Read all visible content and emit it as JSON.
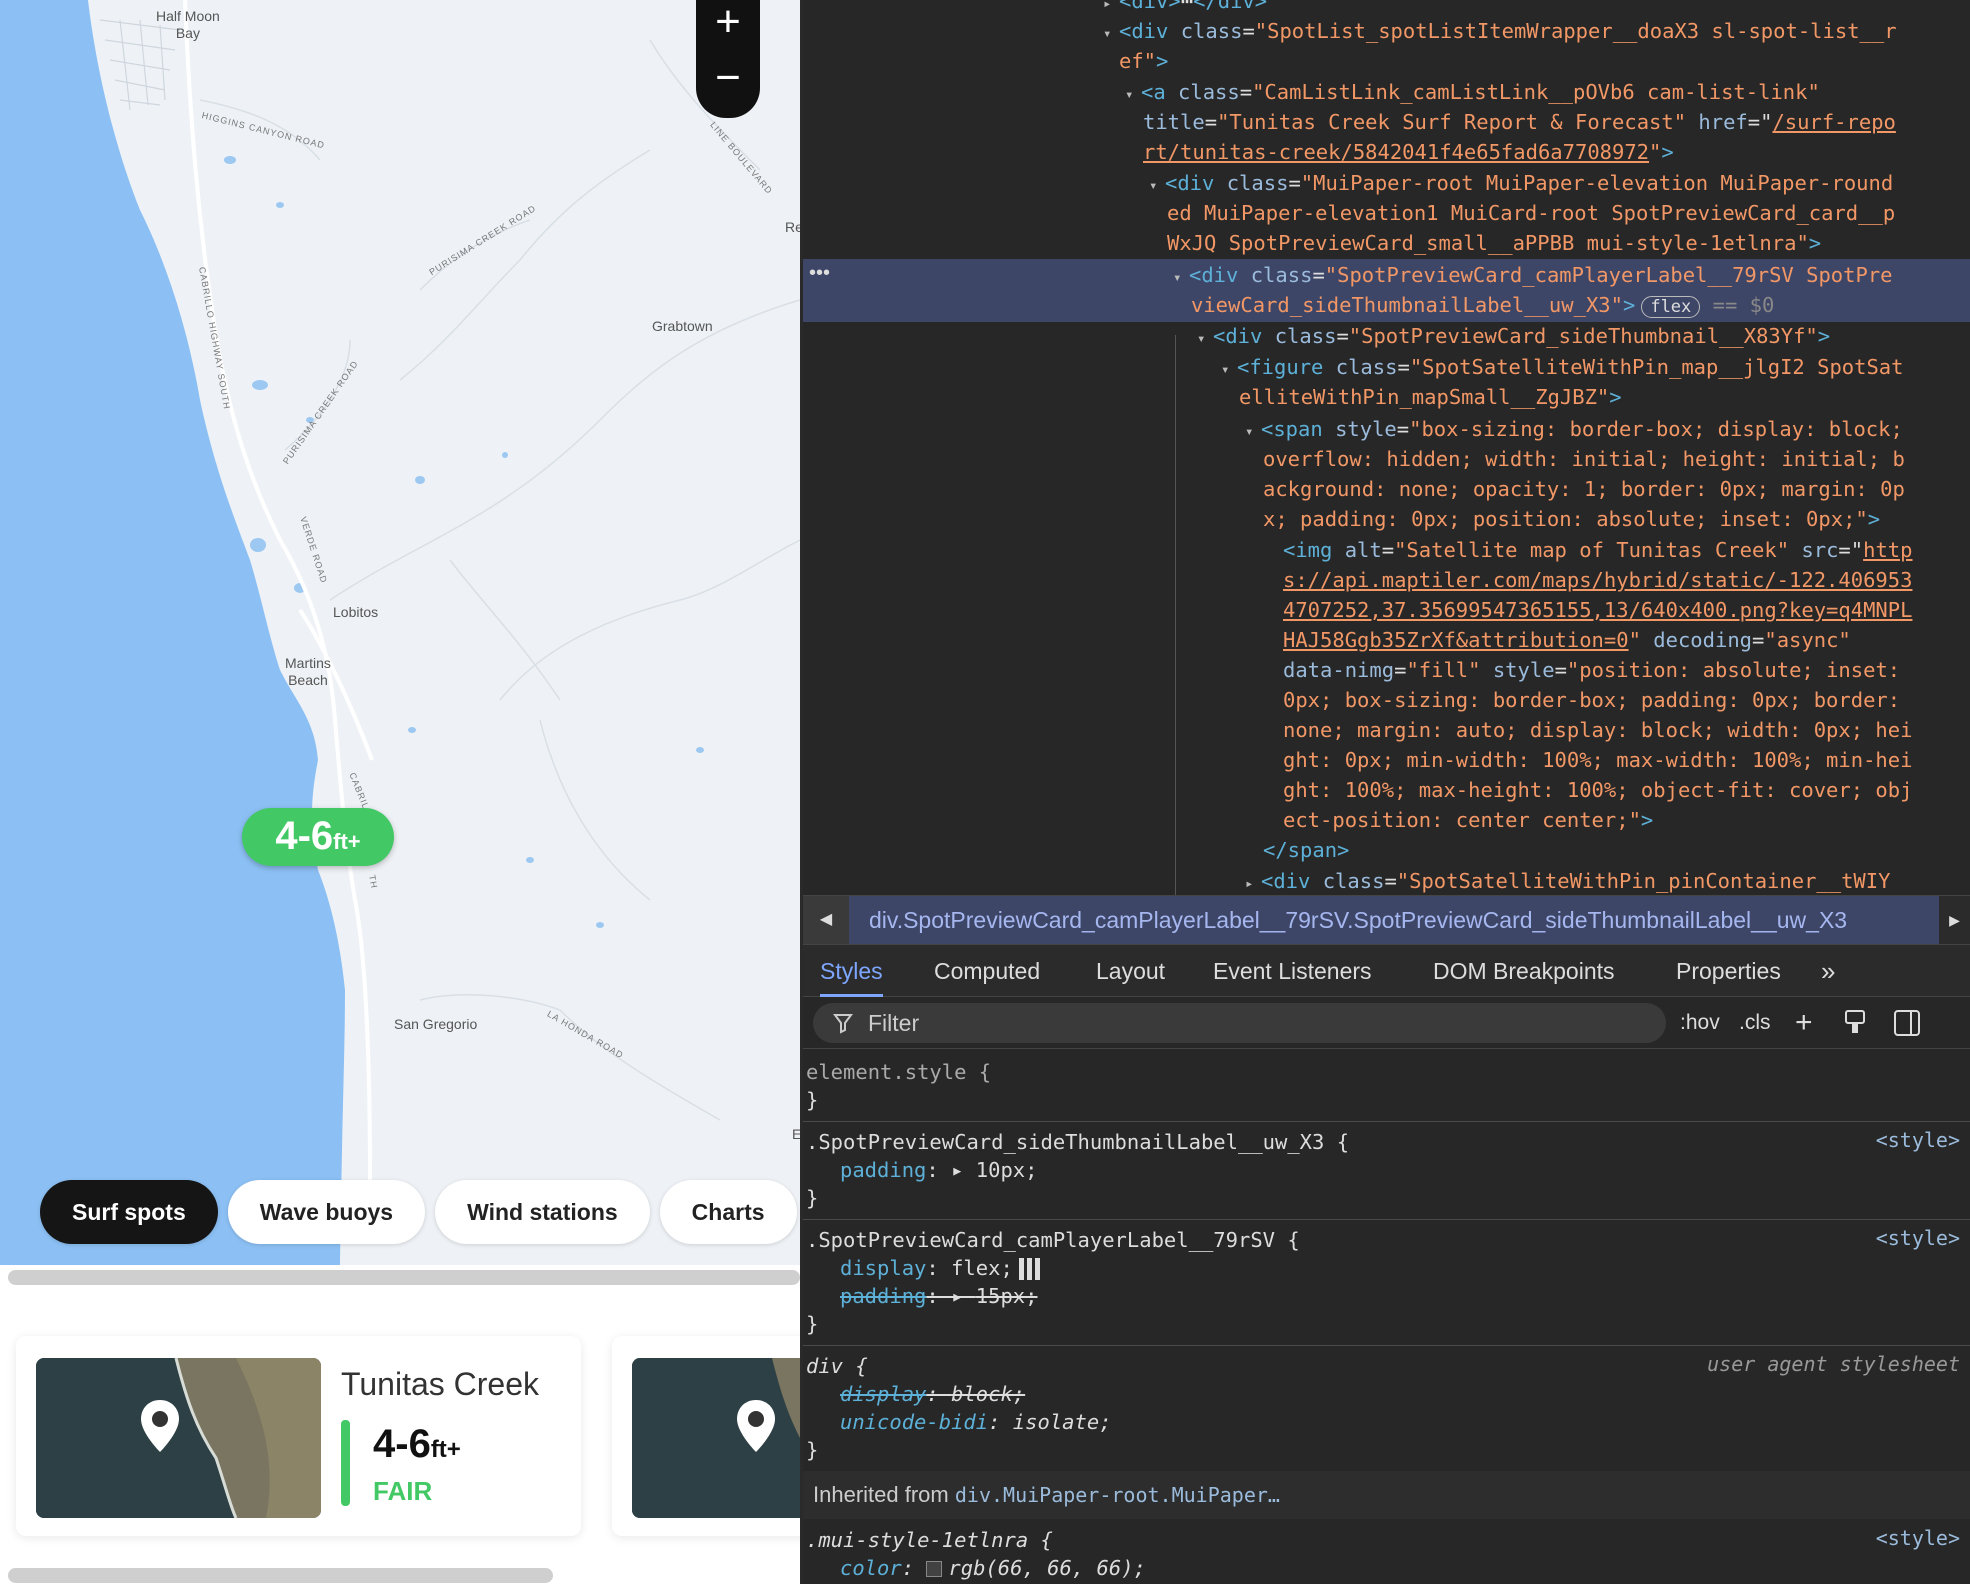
{
  "map": {
    "places": {
      "half_moon_bay": "Half Moon\nBay",
      "grabtown": "Grabtown",
      "lobitos": "Lobitos",
      "martins_beach": "Martins\nBeach",
      "san_gregorio": "San Gregorio",
      "re": "Re",
      "e": "E"
    },
    "roads": {
      "higgins": "Higgins Canyon Road",
      "purisima1": "Purisima Creek Road",
      "purisima2": "Purisima Creek Road",
      "cabrillo": "Cabrillo Highway South",
      "verde": "Verde Road",
      "cabrillo2": "Cabrillo",
      "line_blvd": "Line Boulevard",
      "la_honda": "La Honda Road",
      "th": "TH"
    },
    "zoom_in": "+",
    "zoom_out": "−",
    "marker": {
      "height": "4-6",
      "unit": "ft+"
    },
    "chips": [
      "Surf spots",
      "Wave buoys",
      "Wind stations",
      "Charts"
    ],
    "active_chip": "Surf spots",
    "scroll_progress": 0.55
  },
  "card": {
    "title": "Tunitas Creek",
    "height": "4-6",
    "unit": "ft+",
    "rating": "FAIR",
    "rating_color": "#43c866"
  },
  "devtools": {
    "dom_lines": {
      "l0": "</div>",
      "l1_tag": "div",
      "l1_attr": "class",
      "l1_val": "\"SpotList_spotListItemWrapper__doaX3 sl-spot-list__r",
      "l2_val": "ef\"",
      "l3_tag": "a",
      "l3_val": "\"CamListLink_camListLink__pOVb6 cam-list-link\"",
      "l4_attr": "title",
      "l4_val": "\"Tunitas Creek Surf Report & Forecast\"",
      "l4_attr2": "href",
      "l4_link": "/surf-repo",
      "l5_link": "rt/tunitas-creek/5842041f4e65fad6a7708972",
      "l6_val": "\"MuiPaper-root MuiPaper-elevation MuiPaper-round",
      "l7_val": "ed MuiPaper-elevation1 MuiCard-root SpotPreviewCard_card__p",
      "l8_val": "WxJQ SpotPreviewCard_small__aPPBB mui-style-1etlnra\"",
      "l9_val": "\"SpotPreviewCard_camPlayerLabel__79rSV SpotPre",
      "l10_val": "viewCard_sideThumbnailLabel__uw_X3\"",
      "l10_badge": "flex",
      "l10_eq": "== $0",
      "l11_val": "\"SpotPreviewCard_sideThumbnail__X83Yf\"",
      "l12_tag": "figure",
      "l12_val": "\"SpotSatelliteWithPin_map__jlgI2 SpotSat",
      "l13_val": "elliteWithPin_mapSmall__ZgJBZ\"",
      "l14_tag": "span",
      "l14_attr": "style",
      "l14_val": "\"box-sizing: border-box; display: block;",
      "l15_val": "overflow: hidden; width: initial; height: initial; b",
      "l16_val": "ackground: none; opacity: 1; border: 0px; margin: 0p",
      "l17_val": "x; padding: 0px; position: absolute; inset: 0px;\"",
      "l18_tag": "img",
      "l18_attr": "alt",
      "l18_val": "\"Satellite map of Tunitas Creek\"",
      "l18_attr2": "src",
      "l18_link": "http",
      "l19_link": "s://api.maptiler.com/maps/hybrid/static/-122.406953",
      "l20_link": "4707252,37.35699547365155,13/640x400.png?key=q4MNPL",
      "l21_link": "HAJ58Ggb35ZrXf&attribution=0",
      "l21_attr": "decoding",
      "l21_val": "\"async\"",
      "l22_attr": "data-nimg",
      "l22_val": "\"fill\"",
      "l22_attr2": "style",
      "l22_val2": "\"position: absolute; inset:",
      "l23_val": "0px; box-sizing: border-box; padding: 0px; border:",
      "l24_val": "none; margin: auto; display: block; width: 0px; hei",
      "l25_val": "ght: 0px; min-width: 100%; max-width: 100%; min-hei",
      "l26_val": "ght: 100%; max-height: 100%; object-fit: cover; obj",
      "l27_val": "ect-position: center center;\"",
      "l28": "</span>",
      "l29_val": "\"SpotSatelliteWithPin_pinContainer__tWIY"
    },
    "breadcrumb": "div.SpotPreviewCard_camPlayerLabel__79rSV.SpotPreviewCard_sideThumbnailLabel__uw_X3",
    "tabs": [
      "Styles",
      "Computed",
      "Layout",
      "Event Listeners",
      "DOM Breakpoints",
      "Properties"
    ],
    "active_tab": "Styles",
    "more_tabs": "»",
    "filter_placeholder": "Filter",
    "hov": ":hov",
    "cls": ".cls",
    "styles": {
      "element_style": "element.style {",
      "close": "}",
      "rule1_sel": ".SpotPreviewCard_sideThumbnailLabel__uw_X3 {",
      "rule1_prop": "padding",
      "rule1_val": "10px;",
      "rule1_src": "<style>",
      "rule2_sel": ".SpotPreviewCard_camPlayerLabel__79rSV {",
      "rule2_prop1": "display",
      "rule2_val1": "flex;",
      "rule2_prop2": "padding",
      "rule2_val2": "15px;",
      "rule2_src": "<style>",
      "rule3_sel": "div {",
      "rule3_prop1": "display",
      "rule3_val1": "block;",
      "rule3_prop2": "unicode-bidi",
      "rule3_val2": "isolate;",
      "rule3_src": "user agent stylesheet",
      "inherited_label": "Inherited from",
      "inherited_link": "div.MuiPaper-root.MuiPaper…",
      "rule4_sel": ".mui-style-1etlnra {",
      "rule4_src": "<style>",
      "rule4_prop": "color",
      "rule4_val": "rgb(66, 66, 66);"
    }
  }
}
